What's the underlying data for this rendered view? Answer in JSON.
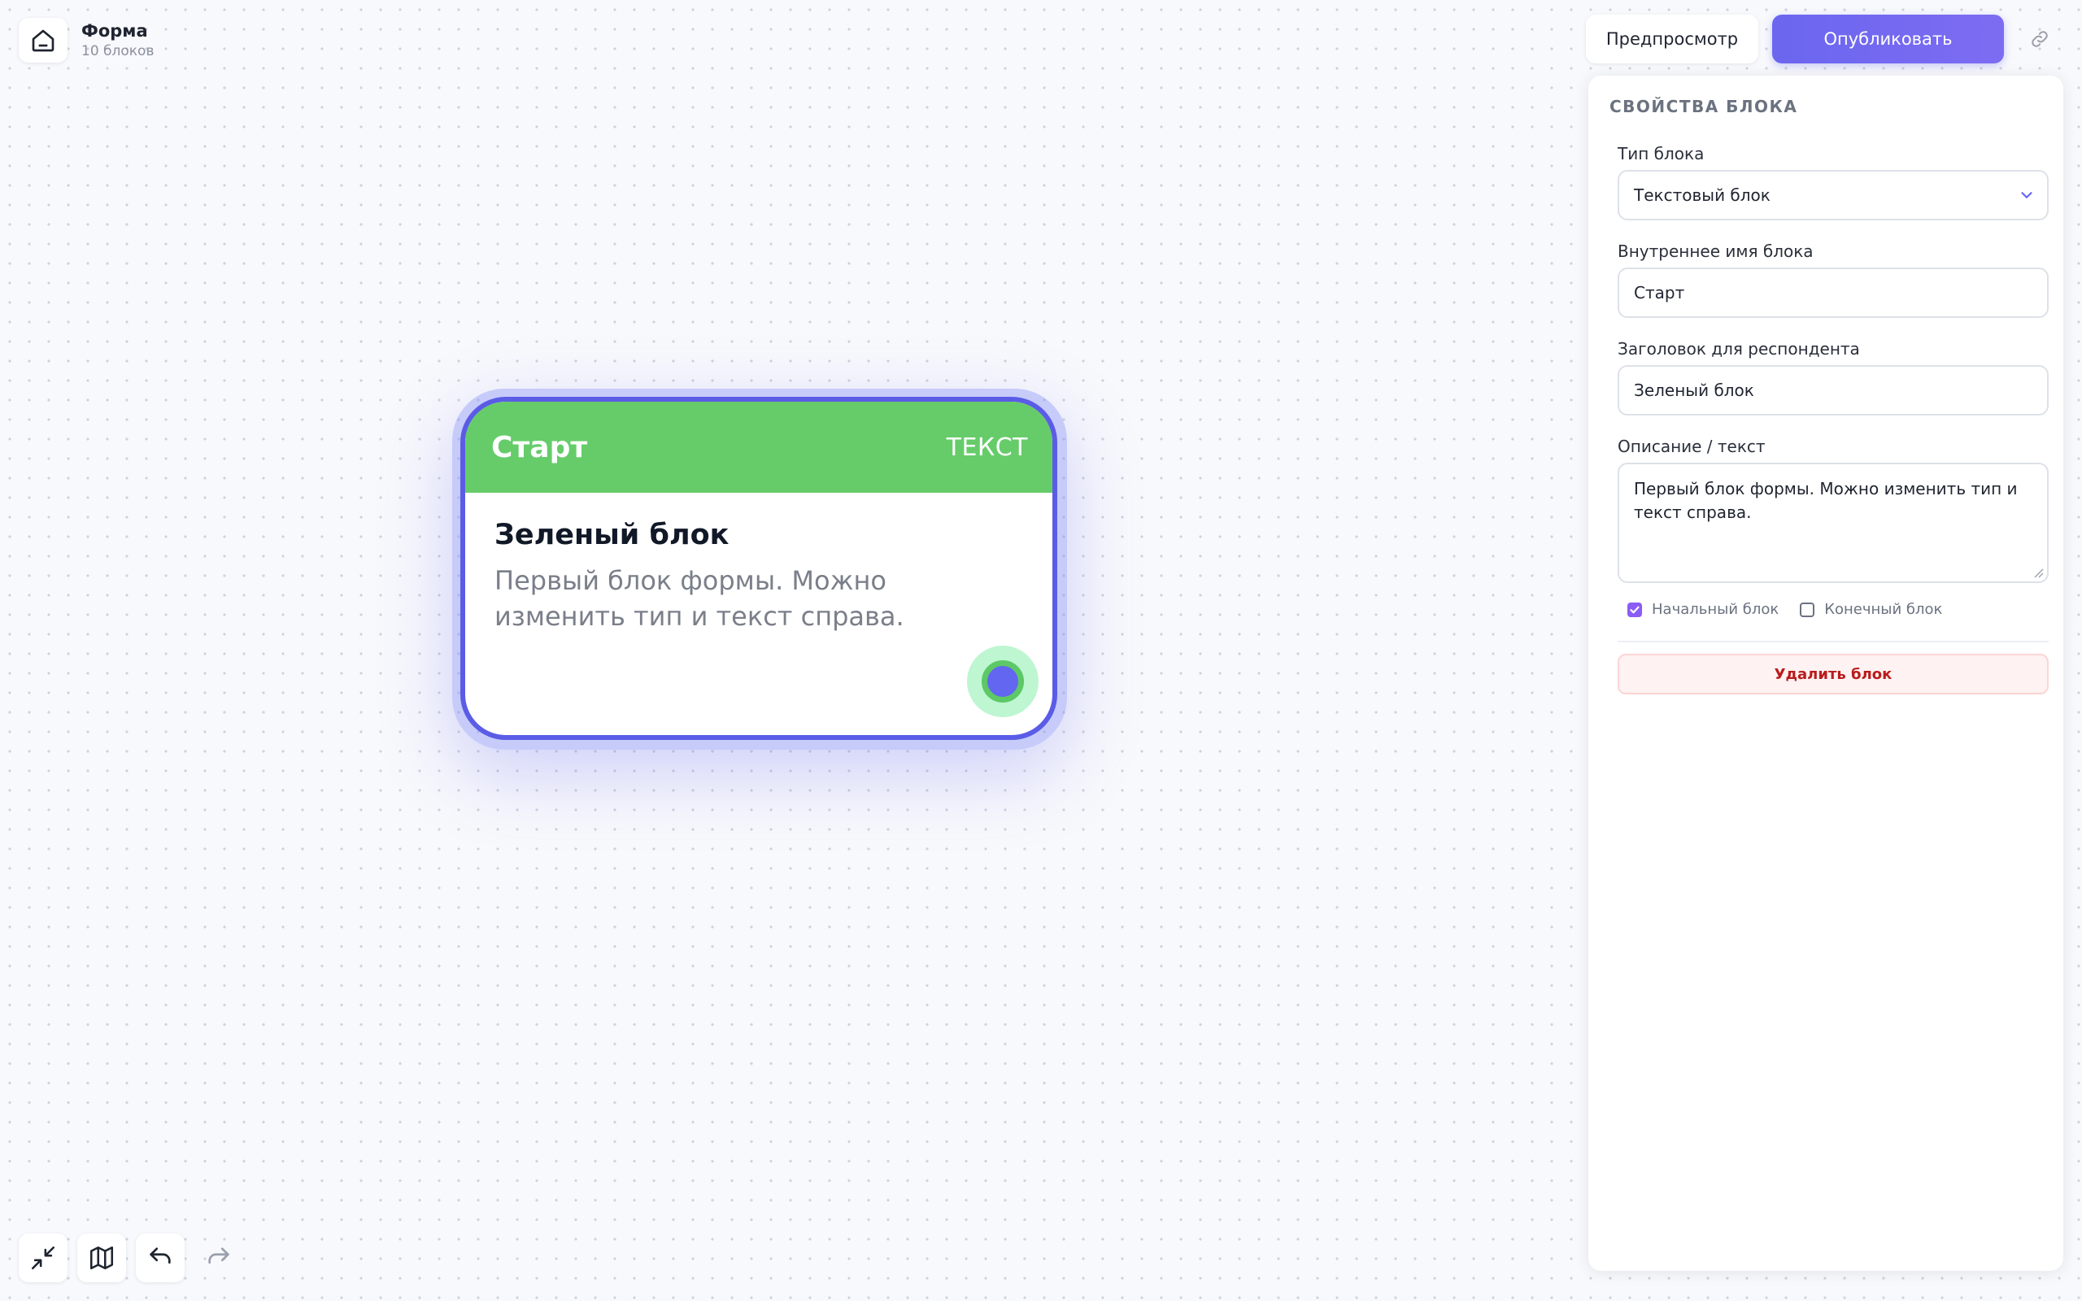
{
  "project": {
    "title": "Форма",
    "subtitle": "10 блоков",
    "home_icon": "home-icon"
  },
  "toolbar": {
    "preview_label": "Предпросмотр",
    "publish_label": "Опубликовать",
    "link_icon": "link-icon"
  },
  "canvas": {
    "node": {
      "name": "Старт",
      "type_label": "ТЕКСТ",
      "title": "Зеленый блок",
      "description": "Первый блок формы. Можно изменить тип и текст справа.",
      "header_color": "#66cc6a",
      "border_color": "#5b5ce6",
      "port_color": "#6366f1"
    }
  },
  "panel": {
    "heading": "СВОЙСТВА БЛОКА",
    "block_type_label": "Тип блока",
    "block_type_value": "Текстовый блок",
    "internal_name_label": "Внутреннее имя блока",
    "internal_name_value": "Старт",
    "respondent_title_label": "Заголовок для респондента",
    "respondent_title_value": "Зеленый блок",
    "description_label": "Описание / текст",
    "description_value": "Первый блок формы. Можно изменить тип и текст справа.",
    "start_block_label": "Начальный блок",
    "start_block_checked": true,
    "end_block_label": "Конечный блок",
    "end_block_checked": false,
    "delete_label": "Удалить блок"
  },
  "bottom_tools": [
    {
      "icon": "collapse-icon"
    },
    {
      "icon": "map-icon"
    },
    {
      "icon": "undo-icon"
    },
    {
      "icon": "redo-icon"
    }
  ],
  "colors": {
    "accent": "#6366f1",
    "publish_gradient_start": "#6b66ef",
    "danger": "#b91c1c"
  }
}
